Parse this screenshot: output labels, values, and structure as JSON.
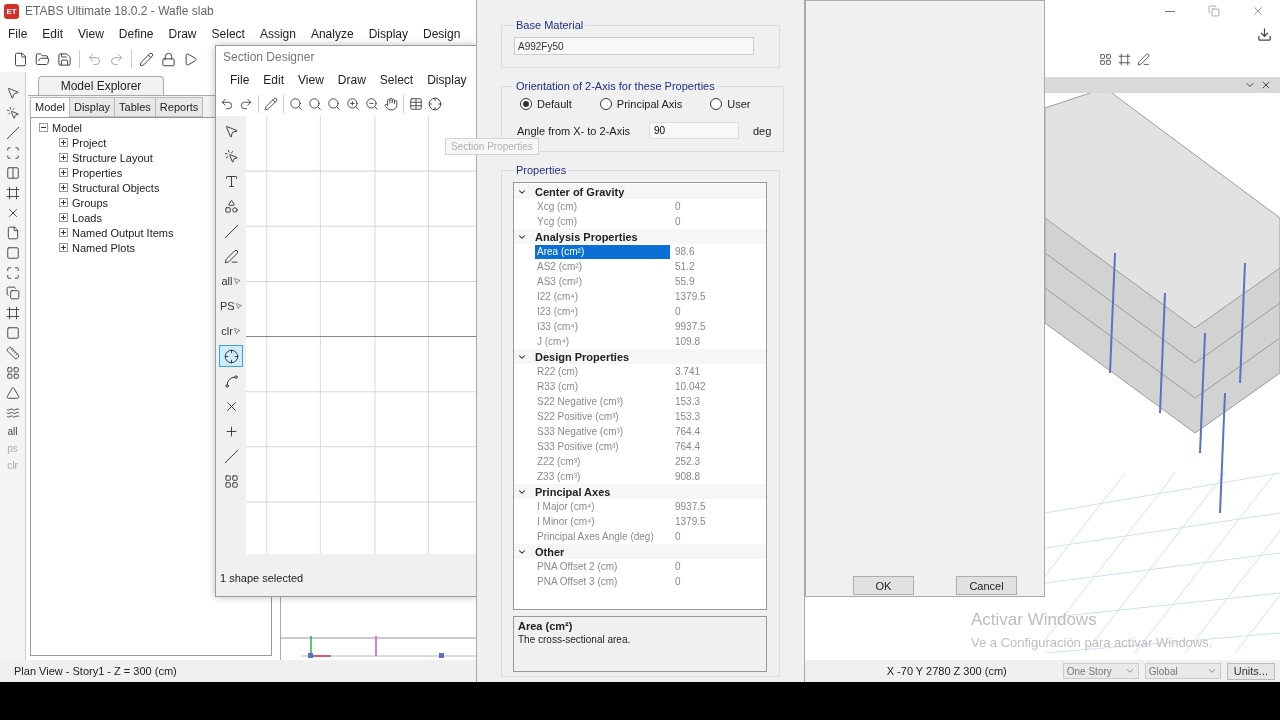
{
  "app": {
    "logo": "ET",
    "title": "ETABS Ultimate 18.0.2 - Wafle slab"
  },
  "menu": [
    "File",
    "Edit",
    "View",
    "Define",
    "Draw",
    "Select",
    "Assign",
    "Analyze",
    "Display",
    "Design"
  ],
  "left_toolbar_labels": [
    {
      "label": "all",
      "disabled": false
    },
    {
      "label": "ps",
      "disabled": true
    },
    {
      "label": "clr",
      "disabled": true
    }
  ],
  "model_explorer": {
    "title": "Model Explorer",
    "tabs": [
      {
        "label": "Model",
        "selected": true
      },
      {
        "label": "Display",
        "selected": false
      },
      {
        "label": "Tables",
        "selected": false
      },
      {
        "label": "Reports",
        "selected": false
      }
    ],
    "tree": [
      {
        "label": "Model",
        "expanded": true,
        "children": [
          {
            "label": "Project",
            "expanded": false
          },
          {
            "label": "Structure Layout",
            "expanded": false
          },
          {
            "label": "Properties",
            "expanded": false
          },
          {
            "label": "Structural Objects",
            "expanded": false
          },
          {
            "label": "Groups",
            "expanded": false
          },
          {
            "label": "Loads",
            "expanded": false
          },
          {
            "label": "Named Output Items",
            "expanded": false
          },
          {
            "label": "Named Plots",
            "expanded": false
          }
        ]
      }
    ]
  },
  "section_designer": {
    "title": "Section Designer",
    "menu": [
      "File",
      "Edit",
      "View",
      "Draw",
      "Select",
      "Display"
    ],
    "tools": [
      {
        "kind": "pointer",
        "selected": false
      },
      {
        "kind": "reshape",
        "selected": false
      },
      {
        "kind": "ishape",
        "selected": false
      },
      {
        "kind": "shape",
        "selected": false
      },
      {
        "kind": "line",
        "selected": false
      },
      {
        "kind": "pen",
        "selected": false
      },
      {
        "kind": "text",
        "label": "all",
        "selected": false
      },
      {
        "kind": "text",
        "label": "PS",
        "selected": false
      },
      {
        "kind": "text",
        "label": "clr",
        "selected": false
      },
      {
        "kind": "snap-point",
        "selected": true
      },
      {
        "kind": "snap-line",
        "selected": false
      },
      {
        "kind": "snap-cross",
        "selected": false
      },
      {
        "kind": "snap-perp",
        "selected": false
      },
      {
        "kind": "snap-end",
        "selected": false
      },
      {
        "kind": "snap-grid",
        "selected": false
      }
    ],
    "status": "1 shape selected"
  },
  "tooltip": "Section Properties",
  "dialog": {
    "base_material": {
      "label": "Base Material",
      "value": "A992Fy50"
    },
    "orientation": {
      "label": "Orientation of 2-Axis for these Properties",
      "options": [
        {
          "label": "Default",
          "selected": true
        },
        {
          "label": "Principal Axis",
          "selected": false
        },
        {
          "label": "User",
          "selected": false
        }
      ],
      "angle_label": "Angle from X- to 2-Axis",
      "angle_value": "90",
      "angle_unit": "deg"
    },
    "properties": {
      "label": "Properties",
      "groups": [
        {
          "name": "Center of Gravity",
          "expanded": true,
          "rows": [
            {
              "name": "Xcg (cm)",
              "value": "0",
              "selected": false
            },
            {
              "name": "Ycg (cm)",
              "value": "0",
              "selected": false
            }
          ]
        },
        {
          "name": "Analysis Properties",
          "expanded": true,
          "rows": [
            {
              "name": "Area (cm²)",
              "value": "98.6",
              "selected": true
            },
            {
              "name": "AS2 (cm²)",
              "value": "51.2",
              "selected": false
            },
            {
              "name": "AS3 (cm²)",
              "value": "55.9",
              "selected": false
            },
            {
              "name": "I22 (cm⁴)",
              "value": "1379.5",
              "selected": false
            },
            {
              "name": "I23 (cm⁴)",
              "value": "0",
              "selected": false
            },
            {
              "name": "I33 (cm⁴)",
              "value": "9937.5",
              "selected": false
            },
            {
              "name": "J (cm⁴)",
              "value": "109.8",
              "selected": false
            }
          ]
        },
        {
          "name": "Design Properties",
          "expanded": true,
          "rows": [
            {
              "name": "R22 (cm)",
              "value": "3.741",
              "selected": false
            },
            {
              "name": "R33 (cm)",
              "value": "10.042",
              "selected": false
            },
            {
              "name": "S22 Negative (cm³)",
              "value": "153.3",
              "selected": false
            },
            {
              "name": "S22 Positive (cm³)",
              "value": "153.3",
              "selected": false
            },
            {
              "name": "S33 Negative (cm³)",
              "value": "764.4",
              "selected": false
            },
            {
              "name": "S33 Positive (cm³)",
              "value": "764.4",
              "selected": false
            },
            {
              "name": "Z22 (cm³)",
              "value": "252.3",
              "selected": false
            },
            {
              "name": "Z33 (cm³)",
              "value": "908.8",
              "selected": false
            }
          ]
        },
        {
          "name": "Principal Axes",
          "expanded": true,
          "rows": [
            {
              "name": "I Major (cm⁴)",
              "value": "9937.5",
              "selected": false
            },
            {
              "name": "I Minor (cm⁴)",
              "value": "1379.5",
              "selected": false
            },
            {
              "name": "Principal Axes Angle (deg)",
              "value": "0",
              "selected": false
            }
          ]
        },
        {
          "name": "Other",
          "expanded": true,
          "rows": [
            {
              "name": "PNA Offset 2 (cm)",
              "value": "0",
              "selected": false
            },
            {
              "name": "PNA Offset 3 (cm)",
              "value": "0",
              "selected": false
            }
          ]
        }
      ]
    },
    "description": {
      "title": "Area (cm²)",
      "text": "The cross-sectional area."
    },
    "buttons": [
      "OK",
      "Cancel"
    ]
  },
  "status_bar": {
    "view": "Plan View - Story1 - Z = 300 (cm)",
    "coordinates": "X -70  Y 2780  Z 300 (cm)",
    "story": "One Story",
    "system": "Global",
    "units": "Units..."
  },
  "activation_notice": {
    "title": "Activar Windows",
    "text": "Ve a Configuración para activar Windows."
  }
}
